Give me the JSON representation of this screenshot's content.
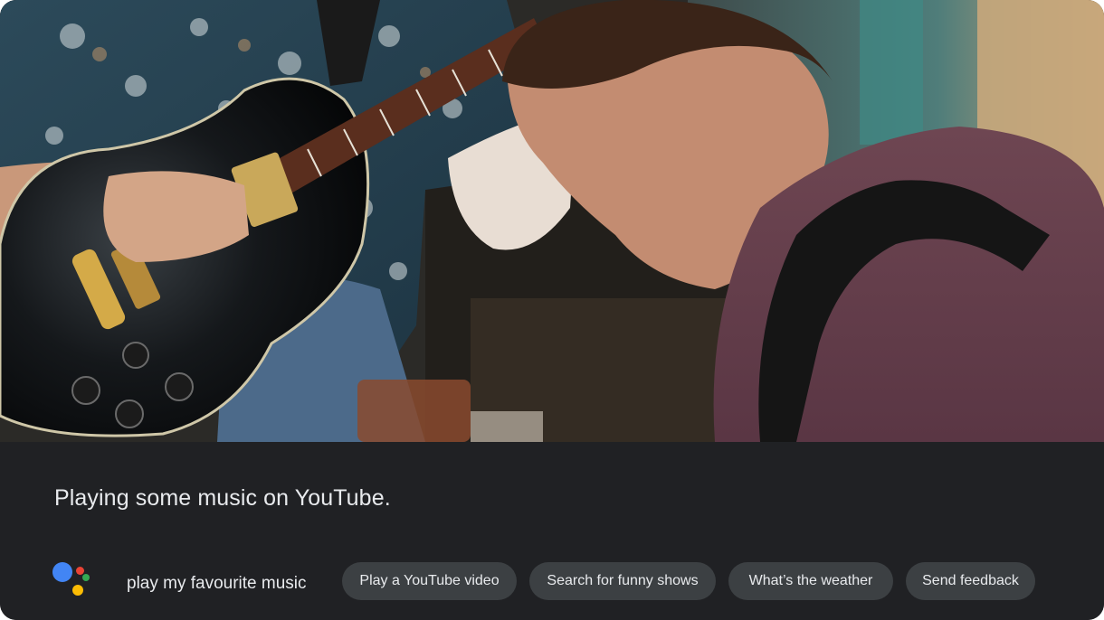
{
  "assistant": {
    "response_text": "Playing some music on YouTube.",
    "user_query": "play my favourite music",
    "logo_icon": "google-assistant-icon",
    "brand_colors": [
      "#4285f4",
      "#ea4335",
      "#34a853",
      "#fbbc04"
    ]
  },
  "suggestions": [
    {
      "label": "Play a YouTube video"
    },
    {
      "label": "Search for funny shows"
    },
    {
      "label": "What’s the weather"
    },
    {
      "label": "Send feedback"
    }
  ],
  "colors": {
    "panel_background": "#202124",
    "chip_background": "#3c4043",
    "text": "#e8eaed"
  }
}
